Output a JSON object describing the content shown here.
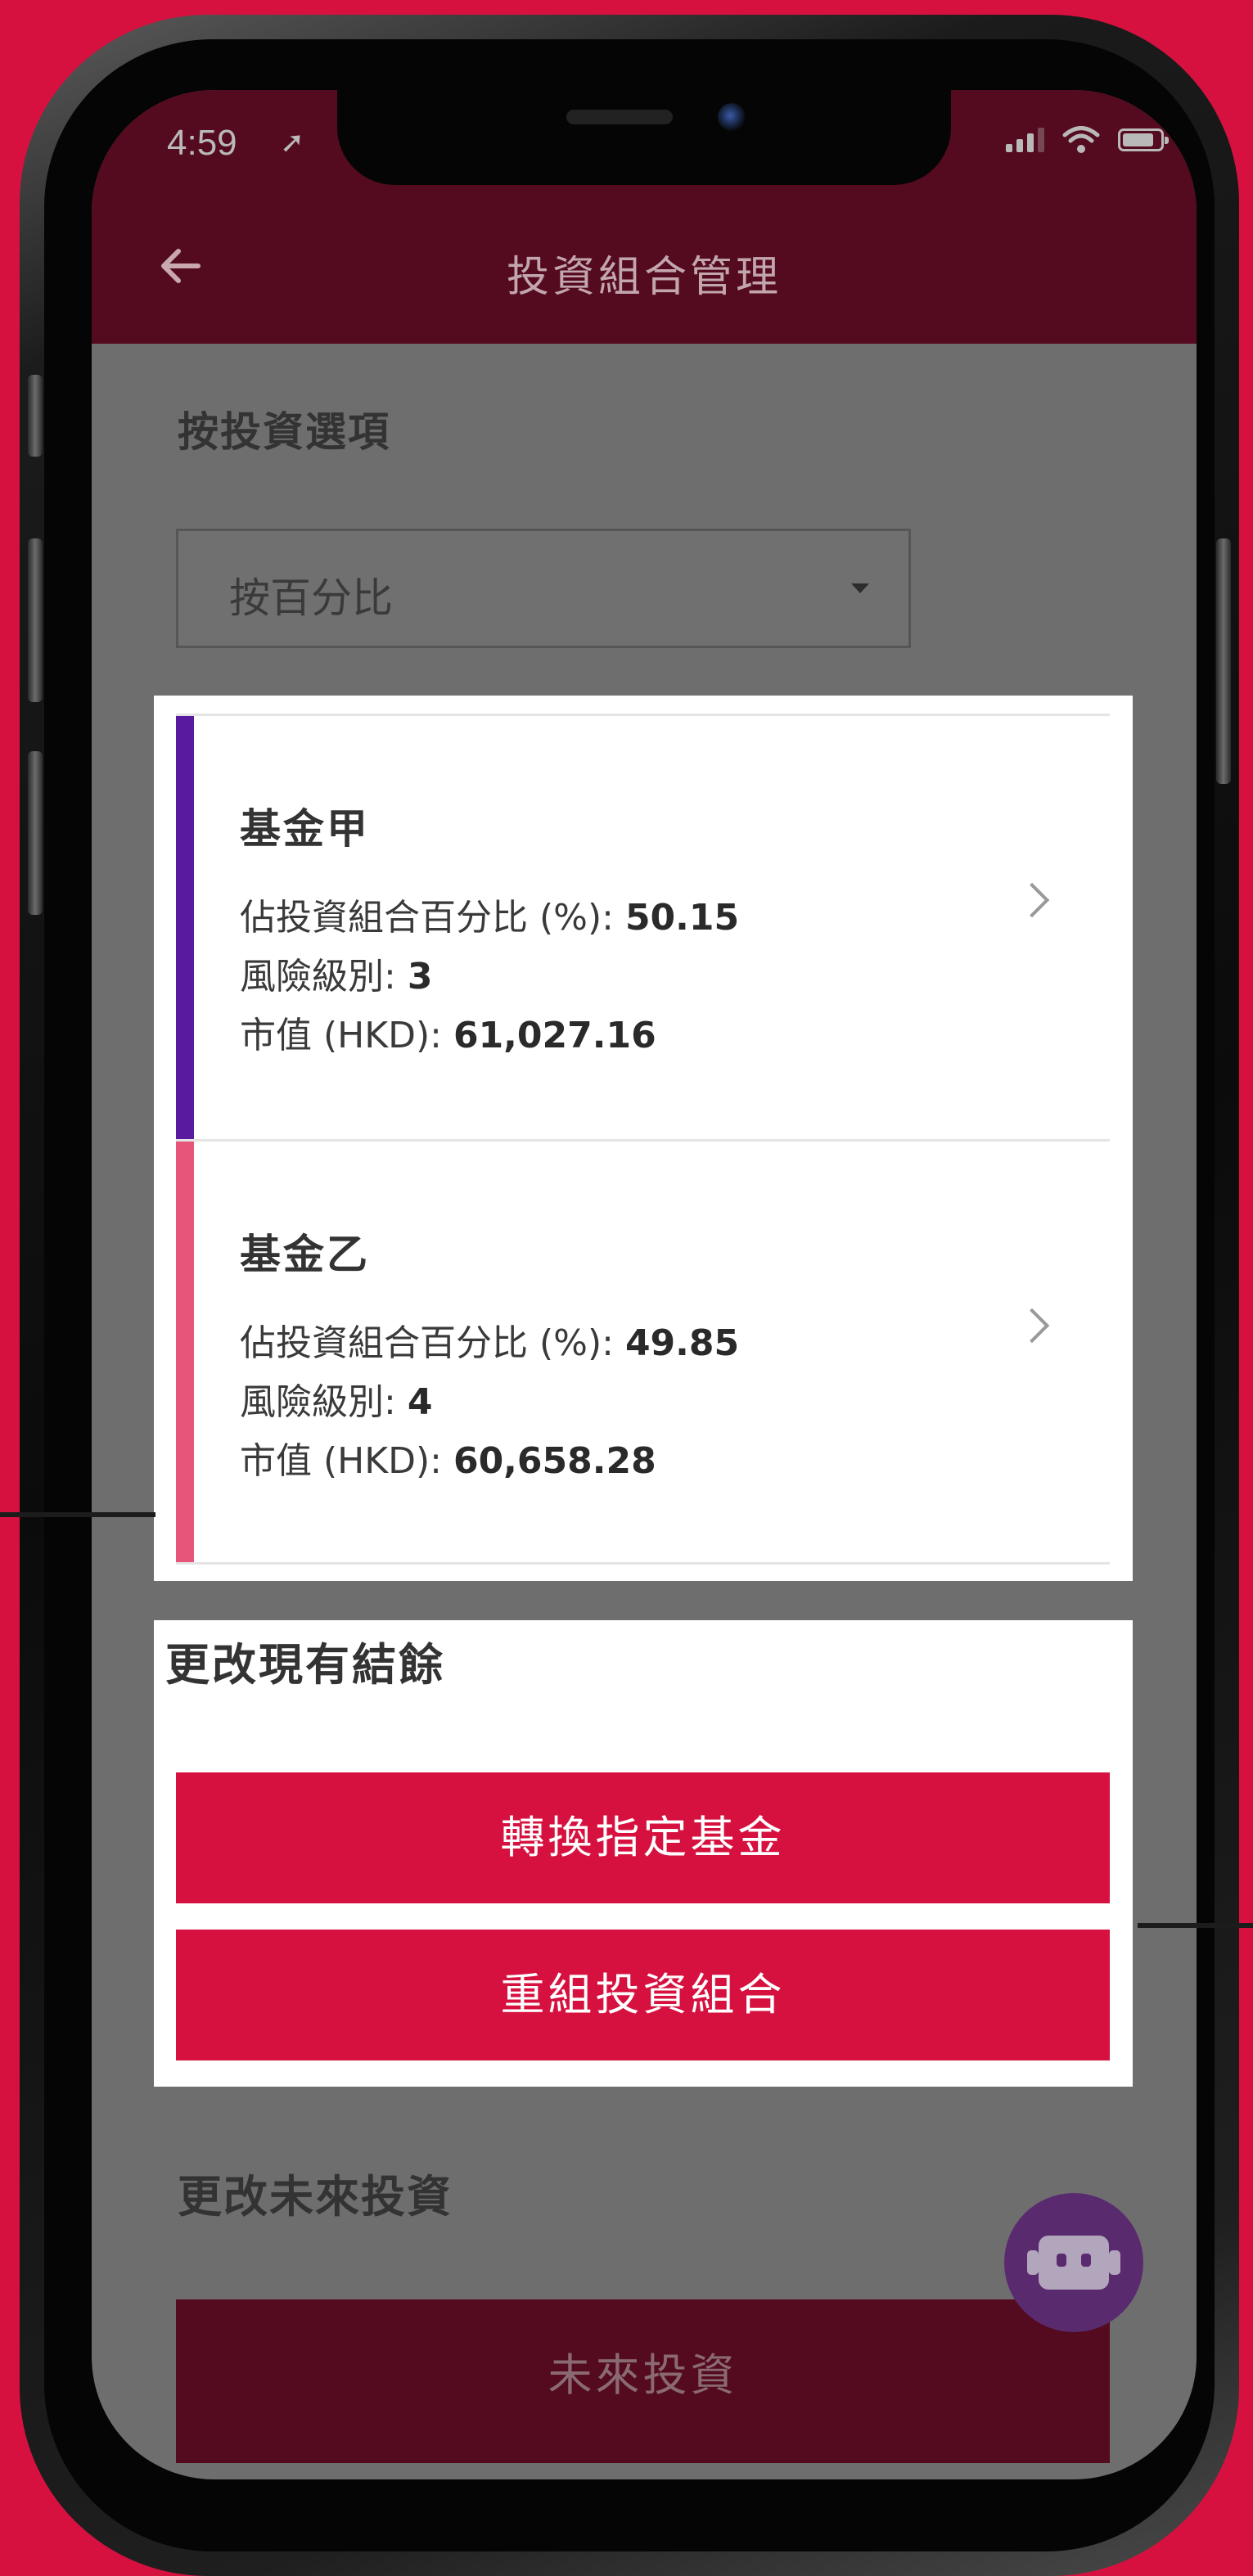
{
  "status_bar": {
    "time": "4:59",
    "location_icon": "location-arrow-icon",
    "signal_icon": "cellular-signal-icon",
    "wifi_icon": "wifi-icon",
    "battery_icon": "battery-icon"
  },
  "app_bar": {
    "back_icon": "back-arrow-icon",
    "title": "投資組合管理"
  },
  "investment_option": {
    "label": "按投資選項",
    "selected": "按百分比"
  },
  "funds": [
    {
      "name": "基金甲",
      "accent_color": "#5a1aa0",
      "percentage_label": "佔投資組合百分比 (%): ",
      "percentage": "50.15",
      "risk_label": "風險級別: ",
      "risk": "3",
      "market_value_label": "市值 (HKD): ",
      "market_value": "61,027.16"
    },
    {
      "name": "基金乙",
      "accent_color": "#e8557a",
      "percentage_label": "佔投資組合百分比 (%): ",
      "percentage": "49.85",
      "risk_label": "風險級別: ",
      "risk": "4",
      "market_value_label": "市值 (HKD): ",
      "market_value": "60,658.28"
    }
  ],
  "change_balance": {
    "title": "更改現有結餘",
    "switch_button": "轉換指定基金",
    "rebalance_button": "重組投資組合"
  },
  "change_future": {
    "title": "更改未來投資",
    "button": "未來投資"
  },
  "chatbot_icon": "robot-icon",
  "colors": {
    "brand_red": "#d6113f",
    "header_maroon": "#540a1f"
  }
}
